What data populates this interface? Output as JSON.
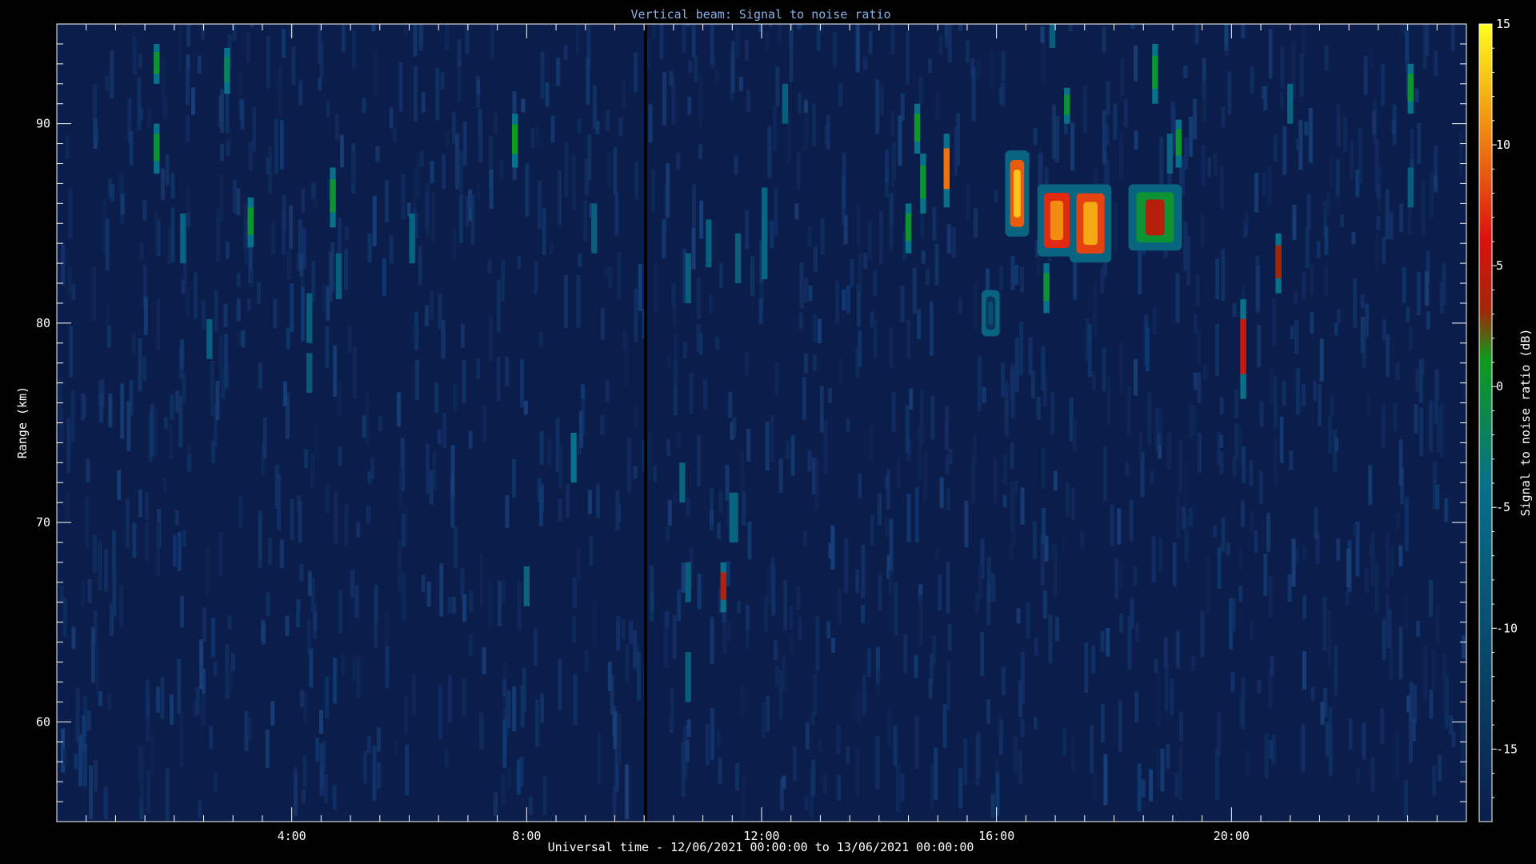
{
  "chart_data": {
    "type": "heatmap",
    "title": "Vertical beam: Signal to noise ratio",
    "xlabel": "Universal time - 12/06/2021 00:00:00 to 13/06/2021 00:00:00",
    "ylabel": "Range (km)",
    "colorbar_label": "Signal to noise ratio (dB)",
    "xlim_hours": [
      0,
      24
    ],
    "ylim_km": [
      55,
      95
    ],
    "clim_db": [
      -18,
      15
    ],
    "x_ticks": [
      {
        "hour": 4,
        "label": "4:00"
      },
      {
        "hour": 8,
        "label": "8:00"
      },
      {
        "hour": 12,
        "label": "12:00"
      },
      {
        "hour": 16,
        "label": "16:00"
      },
      {
        "hour": 20,
        "label": "20:00"
      }
    ],
    "y_ticks": [
      {
        "km": 60,
        "label": "60"
      },
      {
        "km": 70,
        "label": "70"
      },
      {
        "km": 80,
        "label": "80"
      },
      {
        "km": 90,
        "label": "90"
      }
    ],
    "colorbar_ticks": [
      {
        "db": 15,
        "label": "15"
      },
      {
        "db": 10,
        "label": "10"
      },
      {
        "db": 5,
        "label": "5"
      },
      {
        "db": 0,
        "label": "0"
      },
      {
        "db": -5,
        "label": "-5"
      },
      {
        "db": -10,
        "label": "-10"
      },
      {
        "db": -15,
        "label": "-15"
      }
    ],
    "background_db": -15,
    "data_gap_hours": [
      10.0,
      10.05
    ],
    "features": [
      {
        "t0": 16.2,
        "t1": 16.5,
        "r0": 84.5,
        "r1": 88.5,
        "peak_db": 13
      },
      {
        "t0": 16.75,
        "t1": 17.3,
        "r0": 83.5,
        "r1": 86.8,
        "peak_db": 11
      },
      {
        "t0": 17.3,
        "t1": 17.9,
        "r0": 83.2,
        "r1": 86.8,
        "peak_db": 12
      },
      {
        "t0": 18.3,
        "t1": 19.1,
        "r0": 83.8,
        "r1": 86.8,
        "peak_db": 4
      },
      {
        "t0": 15.1,
        "t1": 15.2,
        "r0": 85.8,
        "r1": 89.5,
        "peak_db": 10
      },
      {
        "t0": 11.3,
        "t1": 11.4,
        "r0": 65.5,
        "r1": 68.0,
        "peak_db": 4
      },
      {
        "t0": 11.45,
        "t1": 11.6,
        "r0": 69.0,
        "r1": 71.5,
        "peak_db": -5
      },
      {
        "t0": 20.15,
        "t1": 20.25,
        "r0": 76.2,
        "r1": 81.2,
        "peak_db": 5
      },
      {
        "t0": 20.75,
        "t1": 20.85,
        "r0": 81.5,
        "r1": 84.5,
        "peak_db": 3
      },
      {
        "t0": 1.65,
        "t1": 1.75,
        "r0": 92.0,
        "r1": 94.0,
        "peak_db": 0
      },
      {
        "t0": 1.65,
        "t1": 1.75,
        "r0": 87.5,
        "r1": 90.0,
        "peak_db": 0
      },
      {
        "t0": 7.75,
        "t1": 7.85,
        "r0": 87.8,
        "r1": 90.5,
        "peak_db": 1
      },
      {
        "t0": 3.25,
        "t1": 3.35,
        "r0": 83.8,
        "r1": 86.3,
        "peak_db": 0
      },
      {
        "t0": 4.65,
        "t1": 4.75,
        "r0": 84.8,
        "r1": 87.8,
        "peak_db": 0
      },
      {
        "t0": 14.6,
        "t1": 14.7,
        "r0": 88.5,
        "r1": 91.0,
        "peak_db": 1
      },
      {
        "t0": 14.7,
        "t1": 14.8,
        "r0": 85.5,
        "r1": 88.5,
        "peak_db": 0
      },
      {
        "t0": 14.45,
        "t1": 14.55,
        "r0": 83.5,
        "r1": 86.0,
        "peak_db": 0
      },
      {
        "t0": 17.15,
        "t1": 17.25,
        "r0": 90.0,
        "r1": 91.8,
        "peak_db": 0
      },
      {
        "t0": 16.8,
        "t1": 16.9,
        "r0": 80.5,
        "r1": 83.0,
        "peak_db": 0
      },
      {
        "t0": 18.65,
        "t1": 18.75,
        "r0": 91.0,
        "r1": 94.0,
        "peak_db": 0
      },
      {
        "t0": 19.05,
        "t1": 19.15,
        "r0": 87.8,
        "r1": 90.2,
        "peak_db": 0
      },
      {
        "t0": 23.0,
        "t1": 23.1,
        "r0": 90.5,
        "r1": 93.0,
        "peak_db": 0
      },
      {
        "t0": 2.85,
        "t1": 2.95,
        "r0": 91.5,
        "r1": 93.8,
        "peak_db": -2
      },
      {
        "t0": 2.1,
        "t1": 2.2,
        "r0": 83.0,
        "r1": 85.5,
        "peak_db": -5
      },
      {
        "t0": 2.55,
        "t1": 2.65,
        "r0": 78.2,
        "r1": 80.2,
        "peak_db": -6
      },
      {
        "t0": 4.25,
        "t1": 4.35,
        "r0": 79.0,
        "r1": 81.5,
        "peak_db": -6
      },
      {
        "t0": 4.25,
        "t1": 4.35,
        "r0": 76.5,
        "r1": 78.5,
        "peak_db": -7
      },
      {
        "t0": 4.75,
        "t1": 4.85,
        "r0": 81.2,
        "r1": 83.5,
        "peak_db": -6
      },
      {
        "t0": 6.0,
        "t1": 6.1,
        "r0": 83.0,
        "r1": 85.5,
        "peak_db": -5
      },
      {
        "t0": 7.95,
        "t1": 8.05,
        "r0": 65.8,
        "r1": 67.8,
        "peak_db": -5
      },
      {
        "t0": 8.75,
        "t1": 8.85,
        "r0": 72.0,
        "r1": 74.5,
        "peak_db": -3
      },
      {
        "t0": 9.1,
        "t1": 9.2,
        "r0": 83.5,
        "r1": 86.0,
        "peak_db": -6
      },
      {
        "t0": 10.6,
        "t1": 10.7,
        "r0": 71.0,
        "r1": 73.0,
        "peak_db": -5
      },
      {
        "t0": 10.7,
        "t1": 10.8,
        "r0": 81.0,
        "r1": 83.5,
        "peak_db": -6
      },
      {
        "t0": 10.7,
        "t1": 10.8,
        "r0": 66.0,
        "r1": 68.0,
        "peak_db": -6
      },
      {
        "t0": 10.7,
        "t1": 10.8,
        "r0": 61.0,
        "r1": 63.5,
        "peak_db": -6
      },
      {
        "t0": 11.05,
        "t1": 11.15,
        "r0": 82.8,
        "r1": 85.2,
        "peak_db": -6
      },
      {
        "t0": 11.55,
        "t1": 11.65,
        "r0": 82.0,
        "r1": 84.5,
        "peak_db": -6
      },
      {
        "t0": 12.0,
        "t1": 12.1,
        "r0": 82.2,
        "r1": 86.8,
        "peak_db": -5
      },
      {
        "t0": 12.35,
        "t1": 12.45,
        "r0": 90.0,
        "r1": 92.0,
        "peak_db": -6
      },
      {
        "t0": 18.9,
        "t1": 19.0,
        "r0": 87.5,
        "r1": 89.5,
        "peak_db": -5
      },
      {
        "t0": 20.95,
        "t1": 21.05,
        "r0": 90.0,
        "r1": 92.0,
        "peak_db": -5
      },
      {
        "t0": 23.0,
        "t1": 23.1,
        "r0": 85.8,
        "r1": 87.8,
        "peak_db": -6
      },
      {
        "t0": 15.8,
        "t1": 16.0,
        "r0": 79.5,
        "r1": 81.5,
        "peak_db": -10
      },
      {
        "t0": 16.9,
        "t1": 17.0,
        "r0": 93.8,
        "r1": 95.0,
        "peak_db": -6
      }
    ]
  }
}
